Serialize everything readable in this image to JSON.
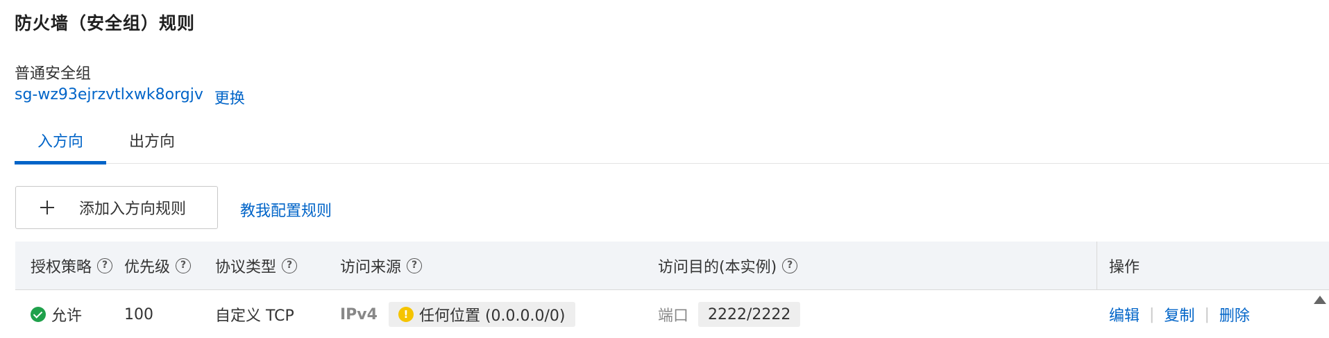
{
  "page": {
    "title": "防火墙（安全组）规则"
  },
  "security_group": {
    "type": "普通安全组",
    "id": "sg-wz93ejrzvtlxwk8orgjv",
    "change_label": "更换"
  },
  "tabs": [
    {
      "label": "入方向",
      "active": true
    },
    {
      "label": "出方向",
      "active": false
    }
  ],
  "toolbar": {
    "add_label": "添加入方向规则",
    "teach_label": "教我配置规则"
  },
  "table": {
    "columns": [
      "授权策略",
      "优先级",
      "协议类型",
      "访问来源",
      "访问目的(本实例)",
      "操作"
    ],
    "help_icon": "?",
    "rows": [
      {
        "policy": "允许",
        "priority": "100",
        "protocol": "自定义 TCP",
        "source_ip_version": "IPv4",
        "source": "任何位置 (0.0.0.0/0)",
        "dest_label": "端口",
        "dest_value": "2222/2222",
        "actions": [
          "编辑",
          "复制",
          "删除"
        ]
      }
    ]
  },
  "colors": {
    "accent": "#0064c8",
    "allow": "#1fa14b",
    "warning": "#f5c400",
    "header_bg": "#f2f4f7"
  }
}
